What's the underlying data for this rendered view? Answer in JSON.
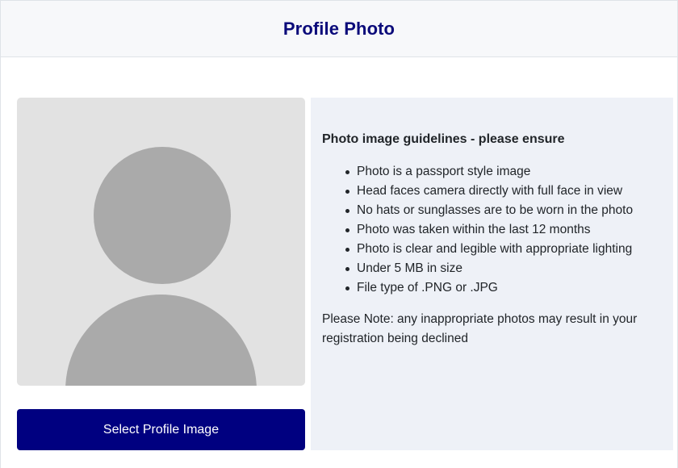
{
  "header": {
    "title": "Profile Photo"
  },
  "photo": {
    "placeholder_icon": "avatar-placeholder-icon"
  },
  "actions": {
    "select_label": "Select Profile Image"
  },
  "guidelines": {
    "heading": "Photo image guidelines - please ensure",
    "items": [
      "Photo is a passport style image",
      "Head faces camera directly with full face in view",
      "No hats or sunglasses are to be worn in the photo",
      "Photo was taken within the last 12 months",
      "Photo is clear and legible with appropriate lighting",
      "Under 5 MB in size",
      "File type of .PNG or .JPG"
    ],
    "note": "Please Note: any inappropriate photos may result in your registration being declined"
  },
  "colors": {
    "title": "#0b0b7a",
    "button_bg": "#000080",
    "guidelines_bg": "#eef1f7",
    "photo_bg": "#e2e2e2",
    "avatar": "#aaaaaa"
  }
}
